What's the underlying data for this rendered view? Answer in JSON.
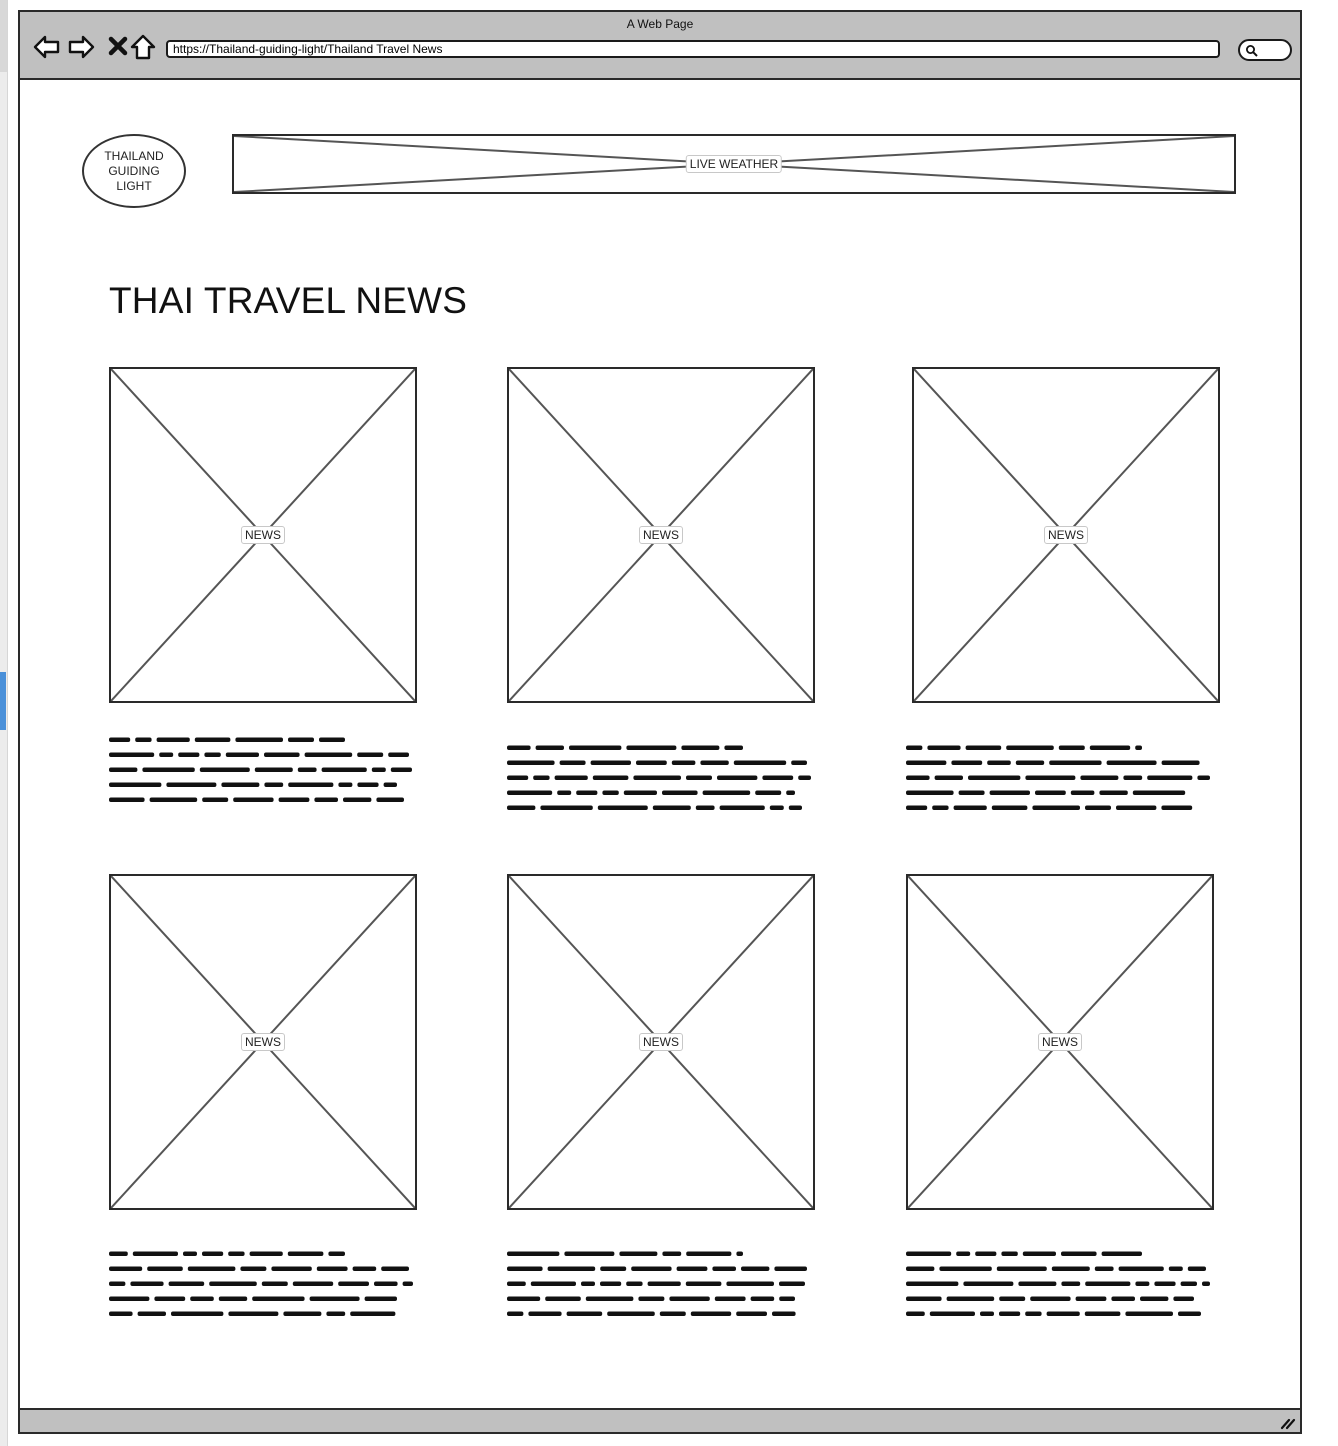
{
  "window": {
    "title": "A Web Page",
    "url": "https://Thailand-guiding-light/Thailand Travel News"
  },
  "toolbar": {
    "back_icon": "back-arrow-icon",
    "forward_icon": "forward-arrow-icon",
    "stop_icon": "close-icon",
    "home_icon": "home-icon",
    "search_icon": "search-icon"
  },
  "header": {
    "logo_lines": [
      "THAILAND",
      "GUIDING",
      "LIGHT"
    ],
    "weather_label": "LIVE WEATHER"
  },
  "main": {
    "title": "THAI TRAVEL NEWS",
    "cards": [
      {
        "image_label": "NEWS"
      },
      {
        "image_label": "NEWS"
      },
      {
        "image_label": "NEWS"
      },
      {
        "image_label": "NEWS"
      },
      {
        "image_label": "NEWS"
      },
      {
        "image_label": "NEWS"
      }
    ]
  },
  "colors": {
    "chrome": "#c0c0c0",
    "border": "#2a2a2a",
    "selection": "#4a90d9"
  }
}
